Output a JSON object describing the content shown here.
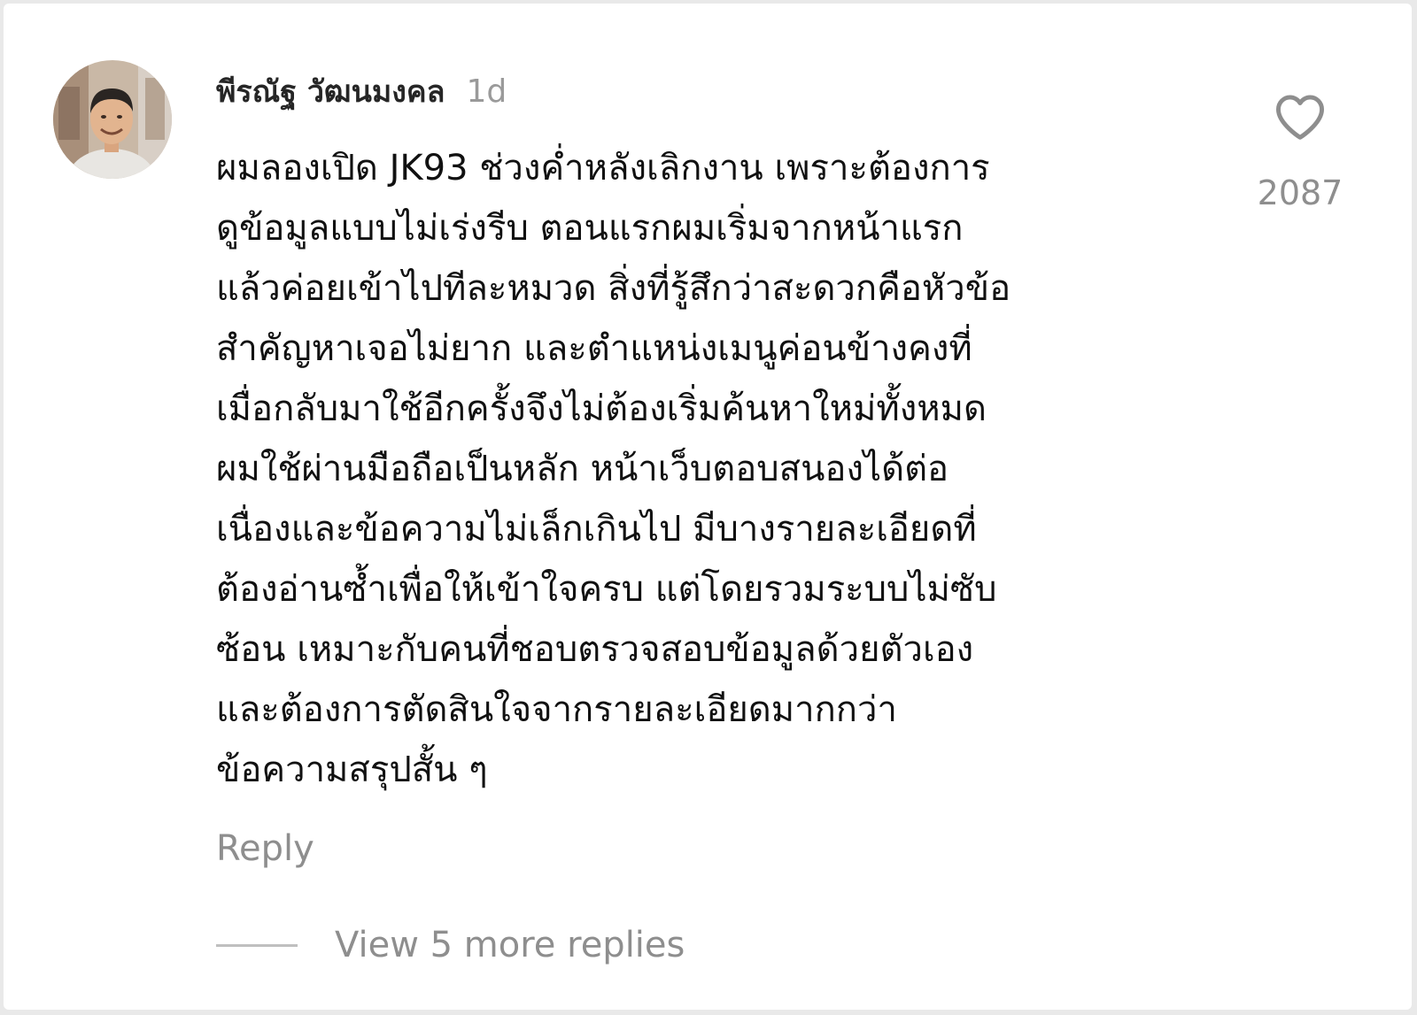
{
  "comment": {
    "author": "พีรณัฐ วัฒนมงคล",
    "time": "1d",
    "avatar_icon": "user-avatar-photo",
    "body_lines": [
      "ผมลองเปิด JK93 ช่วงค่ำหลังเลิกงาน เพราะต้องการ",
      "ดูข้อมูลแบบไม่เร่งรีบ ตอนแรกผมเริ่มจากหน้าแรก",
      "แล้วค่อยเข้าไปทีละหมวด สิ่งที่รู้สึกว่าสะดวกคือหัวข้อ",
      "สำคัญหาเจอไม่ยาก และตำแหน่งเมนูค่อนข้างคงที่",
      "เมื่อกลับมาใช้อีกครั้งจึงไม่ต้องเริ่มค้นหาใหม่ทั้งหมด",
      "ผมใช้ผ่านมือถือเป็นหลัก หน้าเว็บตอบสนองได้ต่อ",
      "เนื่องและข้อความไม่เล็กเกินไป มีบางรายละเอียดที่",
      "ต้องอ่านซ้ำเพื่อให้เข้าใจครบ แต่โดยรวมระบบไม่ซับ",
      "ซ้อน เหมาะกับคนที่ชอบตรวจสอบข้อมูลด้วยตัวเอง",
      "และต้องการตัดสินใจจากรายละเอียดมากกว่า",
      "ข้อความสรุปสั้น ๆ"
    ],
    "like_icon": "heart-outline-icon",
    "like_count": "2087",
    "reply_label": "Reply",
    "view_replies_label": "View 5 more replies"
  },
  "colors": {
    "text_primary": "#111111",
    "text_secondary": "#8e8e8e",
    "background": "#ffffff"
  }
}
